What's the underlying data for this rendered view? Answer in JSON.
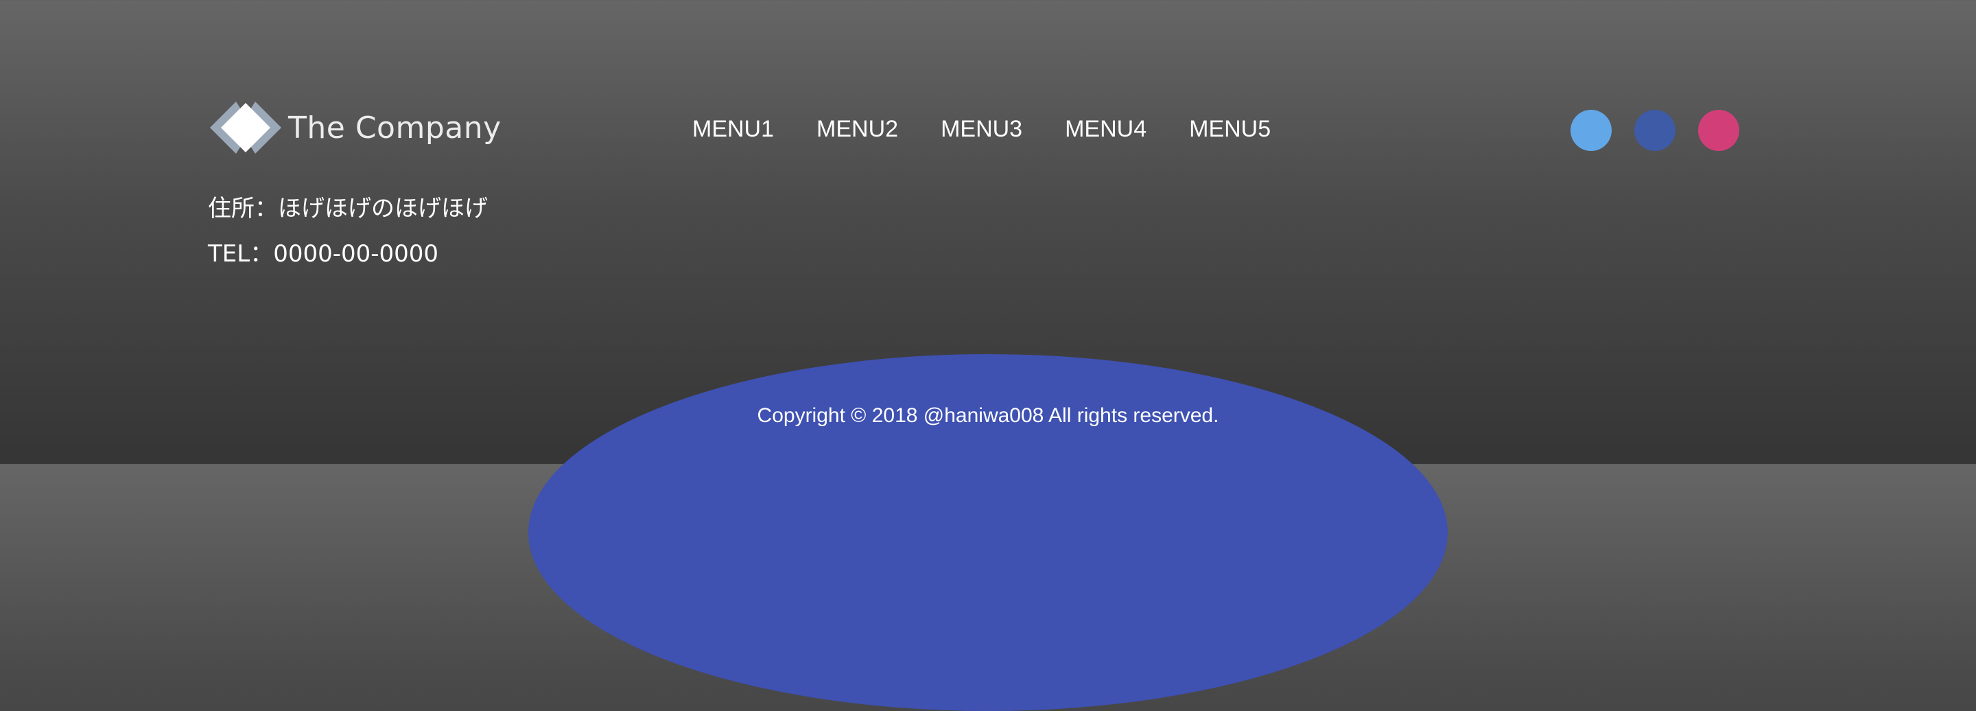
{
  "brand": {
    "name": "The Company",
    "logo_icon": "diamond-logo-icon",
    "logo_colors": {
      "outer": "#9aa8b8",
      "inner": "#ffffff"
    }
  },
  "nav": {
    "items": [
      {
        "label": "MENU1"
      },
      {
        "label": "MENU2"
      },
      {
        "label": "MENU3"
      },
      {
        "label": "MENU4"
      },
      {
        "label": "MENU5"
      }
    ]
  },
  "social": {
    "items": [
      {
        "icon": "social-icon-1",
        "color": "#62a8e8"
      },
      {
        "icon": "social-icon-2",
        "color": "#3d5ba6"
      },
      {
        "icon": "social-icon-3",
        "color": "#d23f78"
      }
    ]
  },
  "contact": {
    "address": "住所：ほげほげのほげほげ",
    "tel": "TEL：0000-00-0000"
  },
  "footer": {
    "copyright": "Copyright © 2018 @haniwa008 All rights reserved.",
    "ellipse_color": "#3f51b1"
  },
  "colors": {
    "background_top": "#666666",
    "background_bottom": "#353535",
    "text": "#ffffff"
  }
}
